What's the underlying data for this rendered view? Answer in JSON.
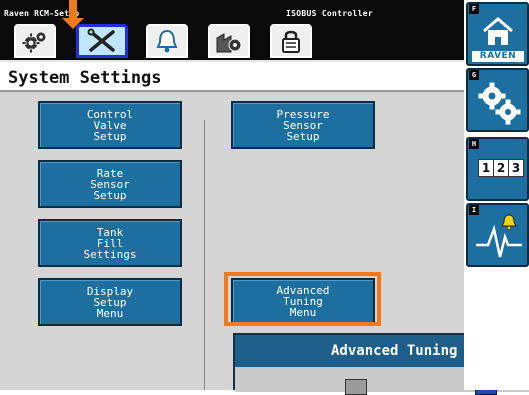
{
  "top_bar": {
    "left_title": "Raven RCM-Setup",
    "right_title": "ISOBUS Controller",
    "tabs": [
      {
        "icon": "gears-icon",
        "active": false
      },
      {
        "icon": "wrench-screwdriver-icon",
        "active": true
      },
      {
        "icon": "bell-icon",
        "active": false
      },
      {
        "icon": "factory-gear-icon",
        "active": false
      },
      {
        "icon": "padlock-icon",
        "active": false
      }
    ]
  },
  "header": {
    "title": "System Settings"
  },
  "buttons": {
    "control_valve": [
      "Control",
      "Valve",
      "Setup"
    ],
    "rate_sensor": [
      "Rate",
      "Sensor",
      "Setup"
    ],
    "tank_fill": [
      "Tank",
      "Fill",
      "Settings"
    ],
    "display_setup": [
      "Display",
      "Setup",
      "Menu"
    ],
    "pressure_sensor": [
      "Pressure",
      "Sensor",
      "Setup"
    ],
    "advanced_tuning": [
      "Advanced",
      "Tuning",
      "Menu"
    ]
  },
  "sub_window": {
    "title": "Advanced Tuning"
  },
  "softkeys": [
    {
      "letter": "F",
      "icon": "home-icon",
      "label": "RAVEN"
    },
    {
      "letter": "G",
      "icon": "gears-icon"
    },
    {
      "letter": "H",
      "icon": "numeric-keypad-icon",
      "digits": [
        "1",
        "2",
        "3"
      ]
    },
    {
      "letter": "I",
      "icon": "alarm-waveform-icon"
    }
  ],
  "colors": {
    "button_blue": "#1d6fa0",
    "highlight_orange": "#f27a1a",
    "active_tab_border": "#2330d8",
    "panel_grey": "#d5d5d5"
  }
}
